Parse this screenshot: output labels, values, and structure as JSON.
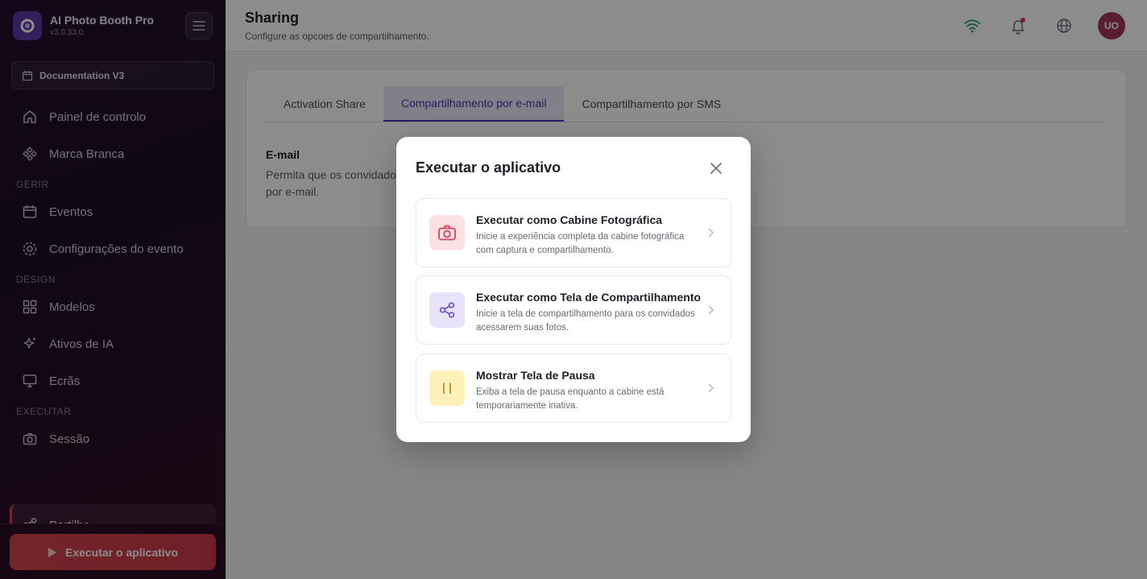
{
  "app": {
    "name": "AI Photo Booth Pro",
    "version": "v3.0.33.0",
    "workspace": "Documentation V3"
  },
  "sidebar": {
    "top_items": [
      {
        "label": "Painel de controlo",
        "icon": "home-icon"
      },
      {
        "label": "Marca Branca",
        "icon": "palette-icon"
      }
    ],
    "sections": [
      {
        "label": "GERIR",
        "items": [
          {
            "label": "Eventos",
            "icon": "calendar-icon"
          },
          {
            "label": "Configurações do evento",
            "icon": "gear-icon"
          }
        ]
      },
      {
        "label": "DESIGN",
        "items": [
          {
            "label": "Modelos",
            "icon": "grid-icon"
          },
          {
            "label": "Ativos de IA",
            "icon": "sparkles-icon"
          },
          {
            "label": "Ecrãs",
            "icon": "monitor-icon"
          }
        ]
      },
      {
        "label": "EXECUTAR",
        "items": [
          {
            "label": "Sessão",
            "icon": "camera-icon"
          },
          {
            "label": "Partilha",
            "icon": "share-icon"
          }
        ]
      }
    ],
    "run_button": "Executar o aplicativo"
  },
  "header": {
    "title": "Sharing",
    "subtitle": "Configure as opcoes de compartilhamento.",
    "avatar_initials": "UO"
  },
  "main": {
    "tabs": [
      {
        "label": "Activation Share",
        "active": false
      },
      {
        "label": "Compartilhamento por e-mail",
        "active": true
      },
      {
        "label": "Compartilhamento por SMS",
        "active": false
      }
    ],
    "field_label": "E-mail",
    "field_desc": "Permita que os convidados por e-mail."
  },
  "modal": {
    "title": "Executar o aplicativo",
    "options": [
      {
        "title": "Executar como Cabine Fotográfica",
        "desc": "Inicie a experiência completa da cabine fotográfica com captura e compartilhamento.",
        "icon": "camera-icon",
        "color": "#e0405a"
      },
      {
        "title": "Executar como Tela de Compartilhamento",
        "desc": "Inicie a tela de compartilhamento para os convidados acessarem suas fotos.",
        "icon": "share-icon",
        "color": "#6b52c6"
      },
      {
        "title": "Mostrar Tela de Pausa",
        "desc": "Exiba a tela de pausa enquanto a cabine está temporariamente inativa.",
        "icon": "pause-icon",
        "color": "#c98a12"
      }
    ]
  },
  "colors": {
    "accent": "#4b33b5",
    "run_button": "#d3424f",
    "wifi": "#1f9d57",
    "notification_dot": "#e0304a"
  }
}
